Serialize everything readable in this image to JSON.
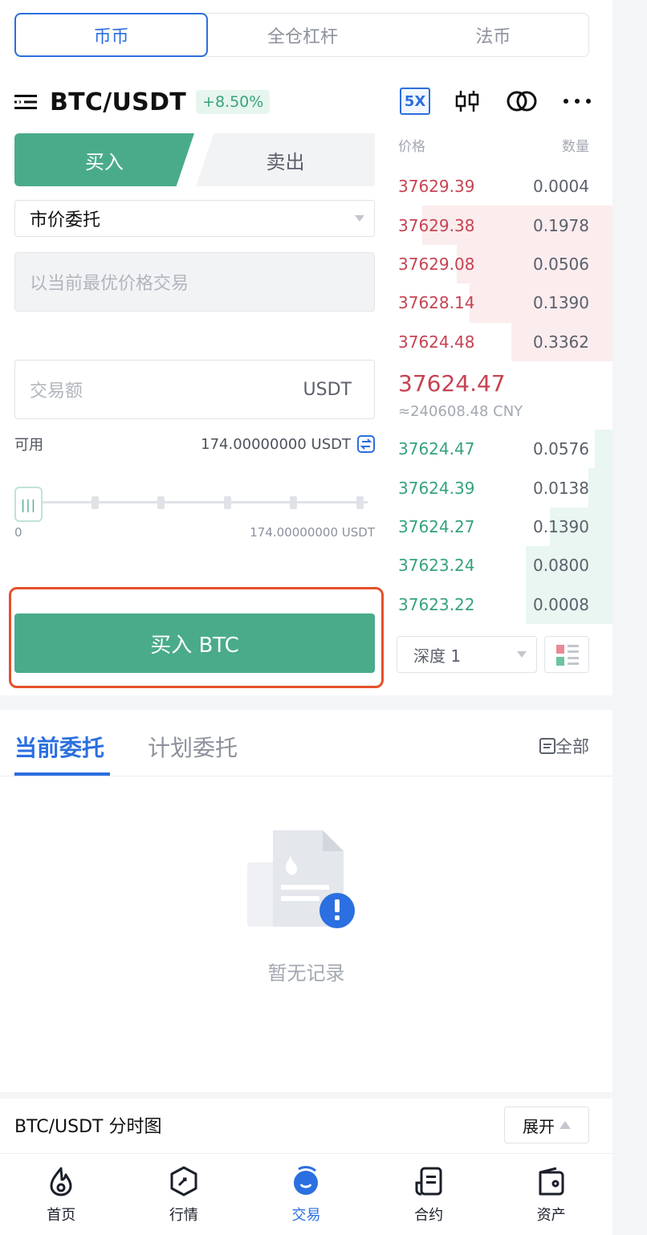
{
  "top_tabs": [
    "币币",
    "全仓杠杆",
    "法币"
  ],
  "pair": {
    "symbol": "BTC/USDT",
    "change": "+8.50%",
    "leverage": "5X"
  },
  "side_tabs": {
    "buy": "买入",
    "sell": "卖出"
  },
  "order_form": {
    "order_type": "市价委托",
    "price_placeholder": "以当前最优价格交易",
    "amount_placeholder": "交易额",
    "amount_unit": "USDT",
    "available_label": "可用",
    "available_value": "174.00000000 USDT",
    "slider_min": "0",
    "slider_max": "174.00000000 USDT",
    "slider_level": 0,
    "submit_label": "买入 BTC"
  },
  "order_book": {
    "price_header": "价格",
    "qty_header": "数量",
    "asks": [
      {
        "price": "37629.39",
        "qty": "0.0004",
        "depth": 0.0
      },
      {
        "price": "37629.38",
        "qty": "0.1978",
        "depth": 0.88
      },
      {
        "price": "37629.08",
        "qty": "0.0506",
        "depth": 0.72
      },
      {
        "price": "37628.14",
        "qty": "0.1390",
        "depth": 0.66
      },
      {
        "price": "37624.48",
        "qty": "0.3362",
        "depth": 0.47
      }
    ],
    "last_price": "37624.47",
    "last_price_cny": "≈240608.48 CNY",
    "bids": [
      {
        "price": "37624.47",
        "qty": "0.0576",
        "depth": 0.08
      },
      {
        "price": "37624.39",
        "qty": "0.0138",
        "depth": 0.11
      },
      {
        "price": "37624.27",
        "qty": "0.1390",
        "depth": 0.29
      },
      {
        "price": "37623.24",
        "qty": "0.0800",
        "depth": 0.4
      },
      {
        "price": "37623.22",
        "qty": "0.0008",
        "depth": 0.4
      }
    ],
    "depth_select": "深度 1"
  },
  "orders": {
    "tab_current": "当前委托",
    "tab_plan": "计划委托",
    "all_label": "全部",
    "empty_text": "暂无记录"
  },
  "chart_bar": {
    "title": "BTC/USDT 分时图",
    "expand_label": "展开"
  },
  "bottom_nav": [
    "首页",
    "行情",
    "交易",
    "合约",
    "资产"
  ],
  "colors": {
    "accent": "#2b6fe0",
    "buy": "#4aab8a",
    "sell": "#c54453",
    "highlight": "#e5502a"
  }
}
